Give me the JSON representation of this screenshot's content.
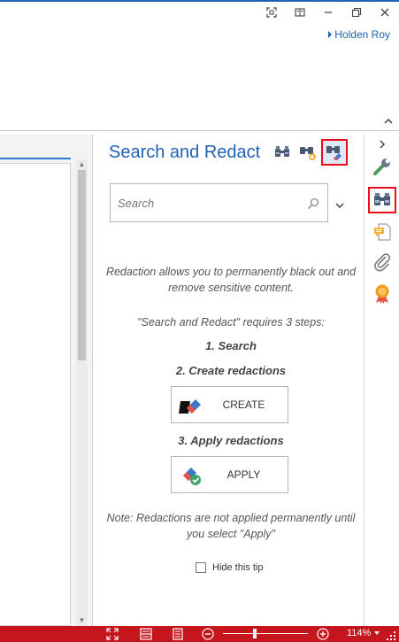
{
  "titlebar": {
    "controls": [
      "fullscreen-icon",
      "reading-mode-icon",
      "minimize-icon",
      "restore-icon",
      "close-icon"
    ]
  },
  "user": {
    "name": "Holden Roy",
    "accent": "#1f63b5"
  },
  "panel": {
    "title": "Search and Redact",
    "tools": [
      "search-binoculars-icon",
      "search-replace-icon",
      "redact-eraser-icon"
    ],
    "search": {
      "placeholder": "Search",
      "value": ""
    },
    "intro": "Redaction allows you to permanently black out and remove sensitive content.",
    "steps_intro": "\"Search and Redact\" requires 3 steps:",
    "step1": "1. Search",
    "step2": "2. Create redactions",
    "create_label": "CREATE",
    "step3": "3. Apply redactions",
    "apply_label": "APPLY",
    "note": "Note: Redactions are not applied permanently until you select \"Apply\"",
    "hide_tip_label": "Hide this tip",
    "hide_tip_checked": false
  },
  "sidebar": {
    "items": [
      "tools-wrench-icon",
      "search-binoculars-icon",
      "comments-icon",
      "attachments-paperclip-icon",
      "certificate-icon"
    ],
    "active": "search-binoculars-icon"
  },
  "statusbar": {
    "zoom": "114%",
    "zoom_fraction": 0.38,
    "color": "#c4161c"
  }
}
